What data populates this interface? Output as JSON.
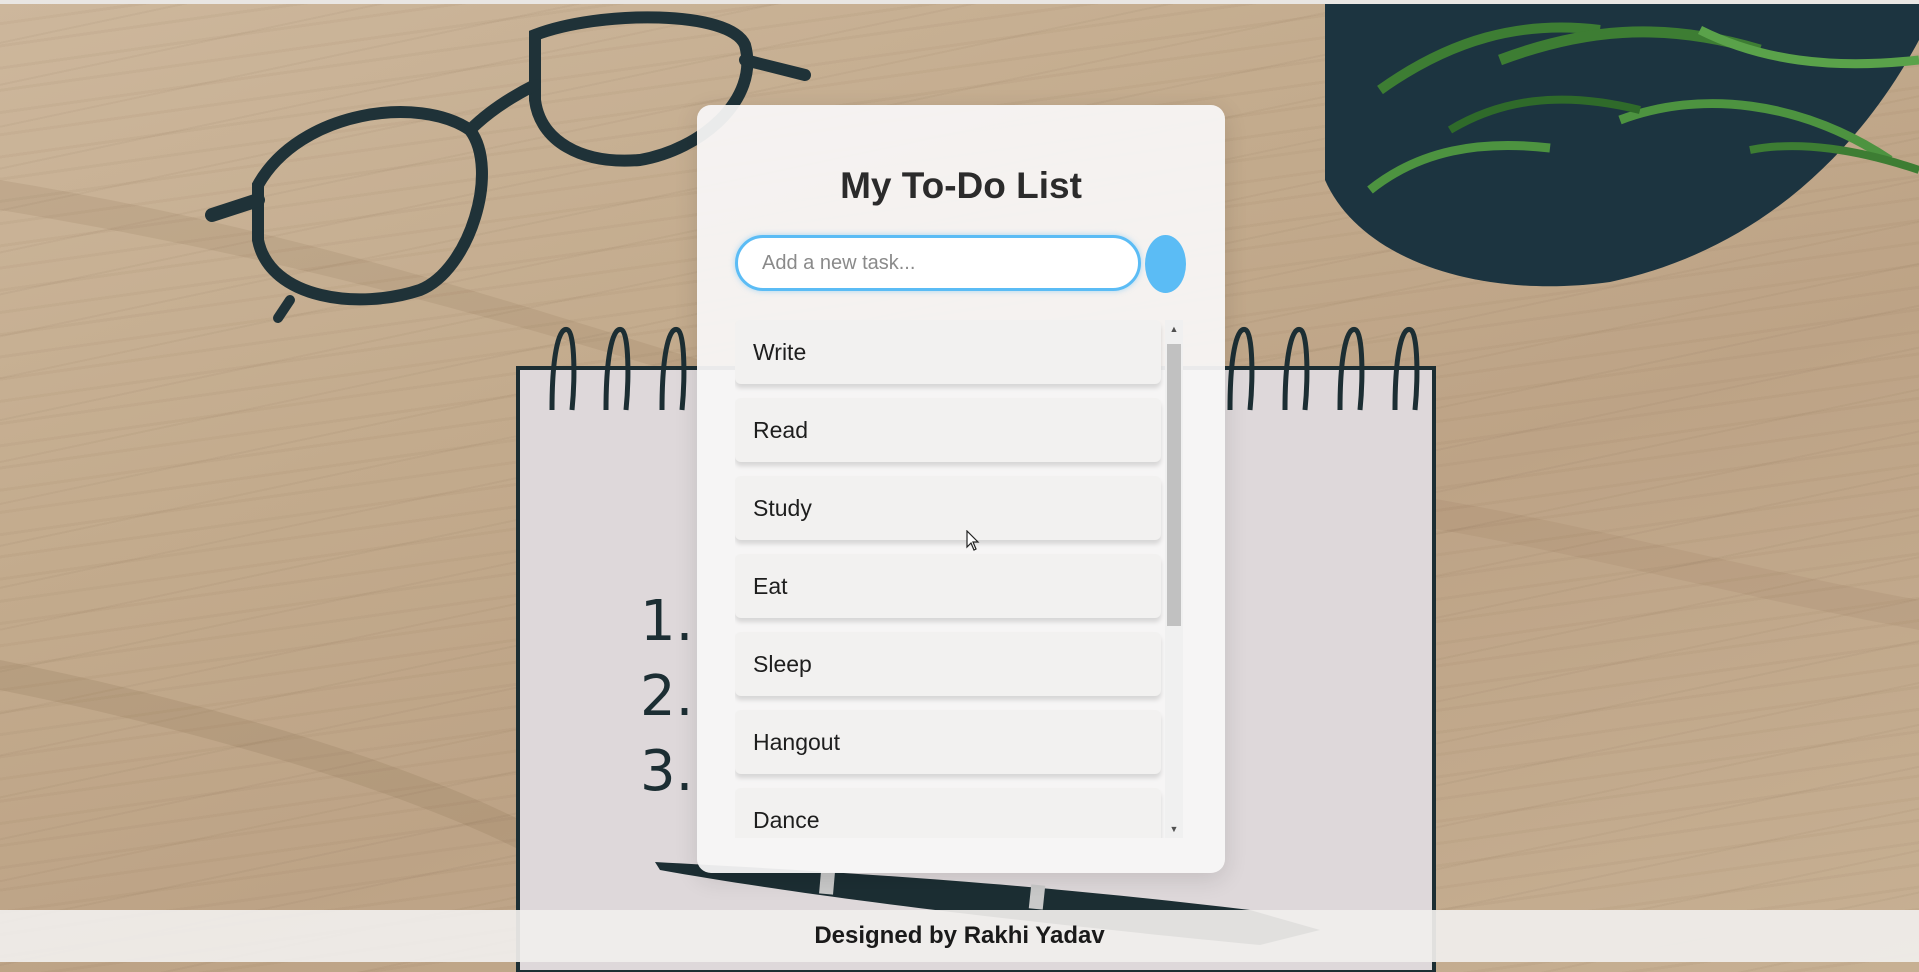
{
  "app": {
    "title": "My To-Do List"
  },
  "input": {
    "value": "",
    "placeholder": "Add a new task..."
  },
  "add_button": {
    "color": "#5bbcf5"
  },
  "tasks": [
    {
      "label": "Write"
    },
    {
      "label": "Read"
    },
    {
      "label": "Study"
    },
    {
      "label": "Eat"
    },
    {
      "label": "Sleep"
    },
    {
      "label": "Hangout"
    },
    {
      "label": "Dance"
    }
  ],
  "notebook": {
    "numbers": [
      "1.",
      "2.",
      "3."
    ]
  },
  "footer": {
    "text": "Designed by Rakhi Yadav"
  },
  "colors": {
    "accent": "#5bbcf5",
    "card": "#f8f7f6",
    "task_item": "#f2f1f0"
  }
}
